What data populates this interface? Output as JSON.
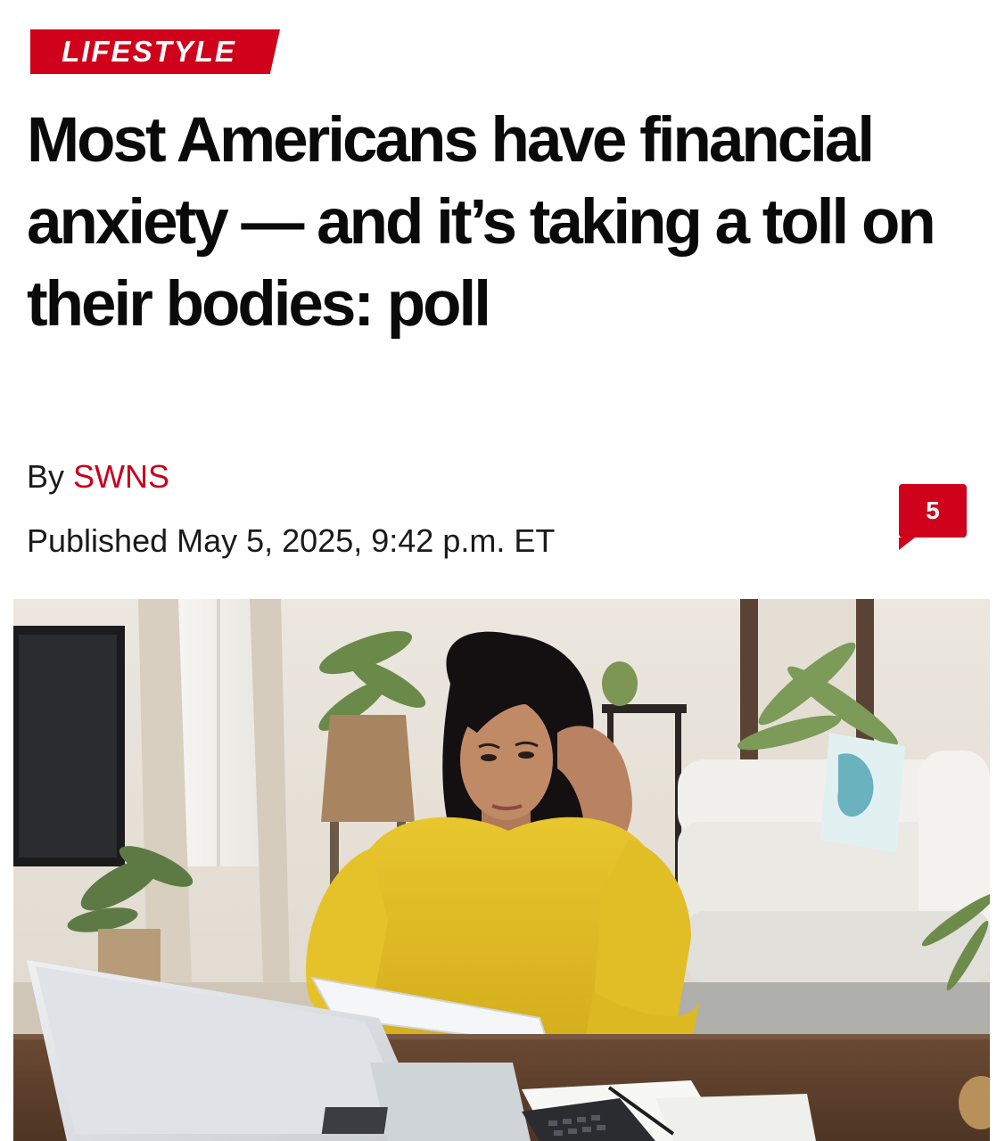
{
  "section": {
    "label": "LIFESTYLE"
  },
  "article": {
    "headline": "Most Americans have financial anxiety — and it’s taking a toll on their bodies: poll",
    "byline_prefix": "By",
    "author": "SWNS",
    "published": "Published May 5, 2025, 9:42 p.m. ET",
    "comment_count": "5"
  },
  "hero_image": {
    "description_icon": "photo-of-woman-at-laptop"
  },
  "colors": {
    "brand_red": "#d0021b",
    "author_link": "#c8001e",
    "text": "#111111"
  }
}
